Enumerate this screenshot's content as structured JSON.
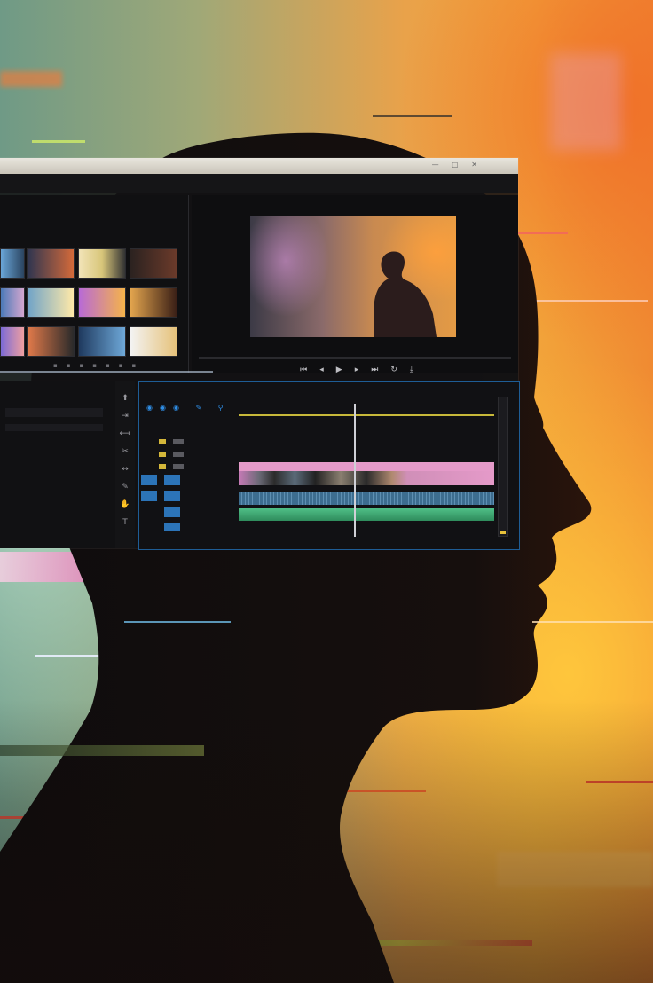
{
  "scene": {
    "subject": "",
    "colors": {
      "left_tint": "#6f9a86",
      "right_tint": "#f2a43a",
      "silhouette": "#120d0c",
      "timecode_blue": "#2f8de4",
      "clip_pink": "#e59ac9",
      "clip_blue": "#3d6d8f",
      "clip_green": "#3aa56e",
      "ruler_yellow": "#c7b83a"
    }
  },
  "editor": {
    "menu_items": [
      "",
      "",
      "",
      "",
      "",
      "",
      ""
    ],
    "program_tab": "",
    "timecode_left": "",
    "timecode_right": "",
    "timeline_header": "",
    "ruler_labels": [
      "",
      "",
      "",
      "",
      "",
      ""
    ],
    "transport_icons": [
      "step-back-icon",
      "play-icon",
      "step-forward-icon",
      "loop-icon",
      "export-icon"
    ]
  }
}
